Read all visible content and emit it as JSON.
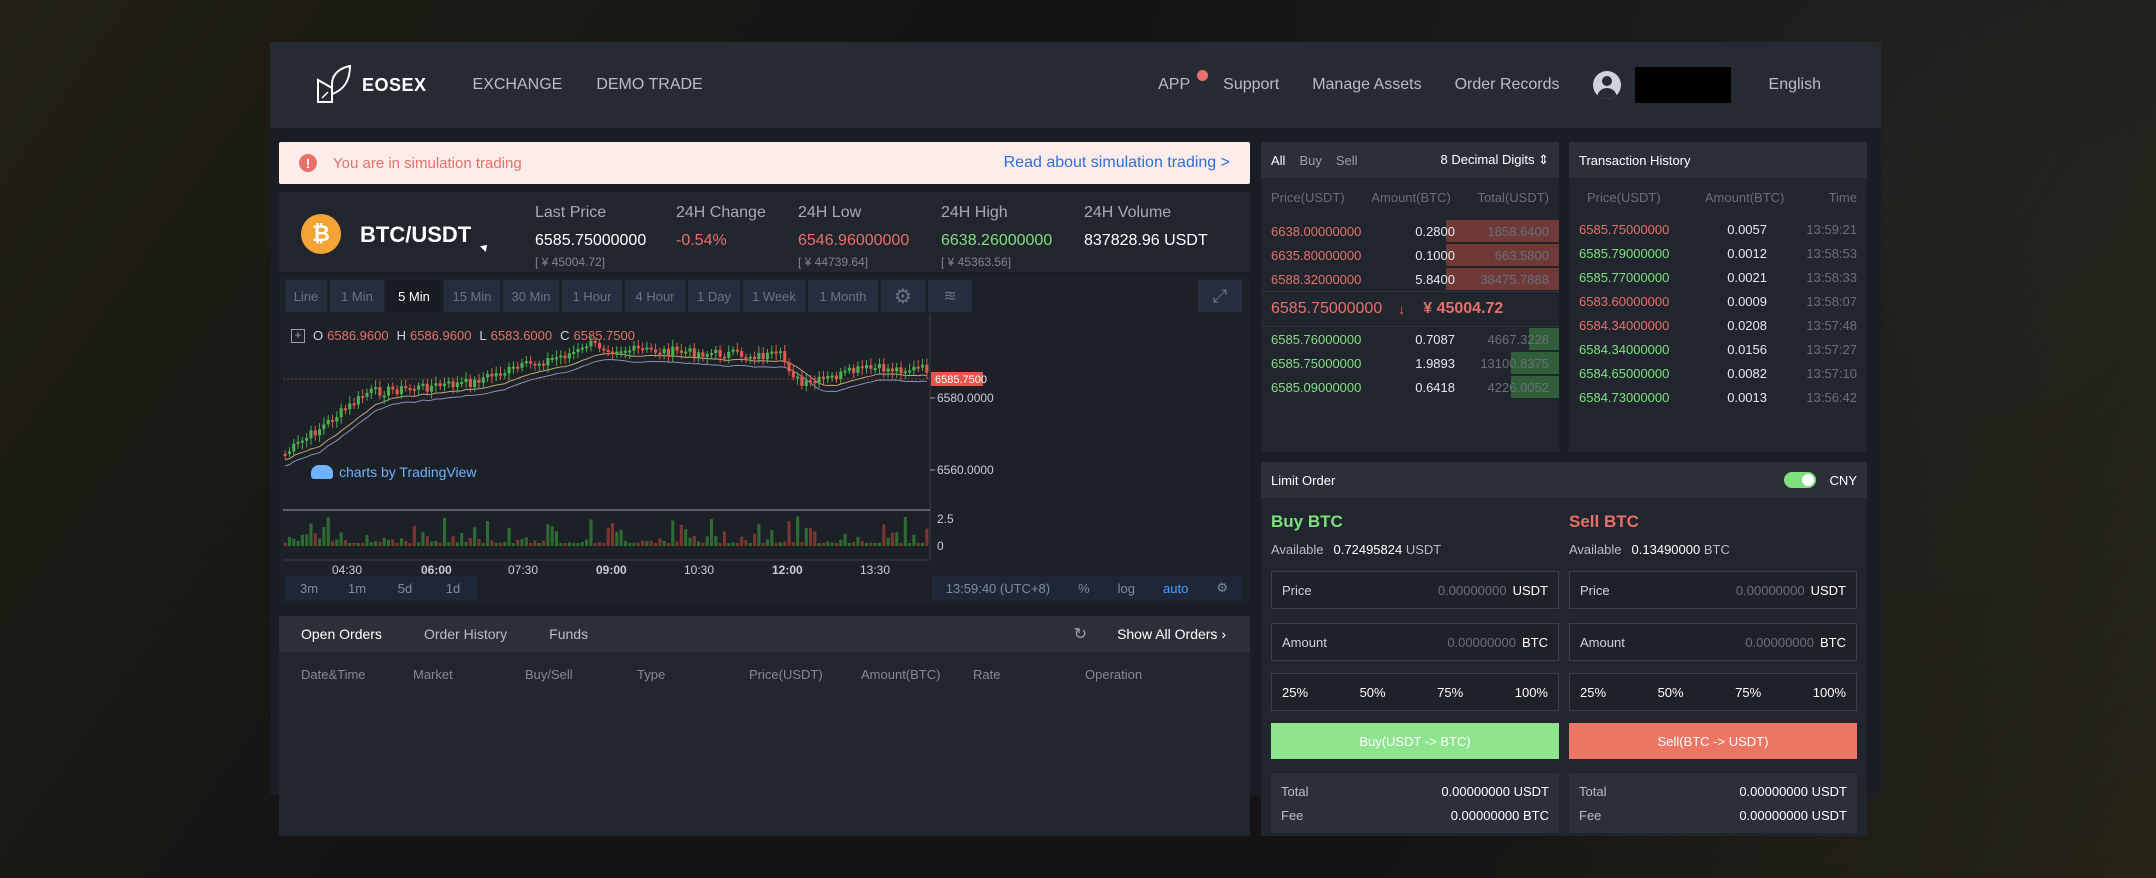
{
  "header": {
    "brand": "EOSEX",
    "nav": [
      "EXCHANGE",
      "DEMO TRADE"
    ],
    "right": {
      "app": "APP",
      "support": "Support",
      "manage_assets": "Manage Assets",
      "order_records": "Order Records",
      "language": "English"
    }
  },
  "notice": {
    "icon": "!",
    "text": "You are in simulation trading",
    "link": "Read about simulation trading >"
  },
  "ticker": {
    "coin_icon": "₿",
    "pair": "BTC/USDT",
    "last_price": {
      "label": "Last Price",
      "value": "6585.75000000",
      "sub": "[ ¥ 45004.72]"
    },
    "change": {
      "label": "24H Change",
      "value": "-0.54%"
    },
    "low": {
      "label": "24H Low",
      "value": "6546.96000000",
      "sub": "[ ¥ 44739.64]"
    },
    "high": {
      "label": "24H High",
      "value": "6638.26000000",
      "sub": "[ ¥ 45363.56]"
    },
    "volume": {
      "label": "24H Volume",
      "value": "837828.96 USDT"
    }
  },
  "chart": {
    "timeframes": [
      "Line",
      "1 Min",
      "5 Min",
      "15 Min",
      "30 Min",
      "1 Hour",
      "4 Hour",
      "1 Day",
      "1 Week",
      "1 Month"
    ],
    "active_timeframe": "5 Min",
    "icons": [
      "gear-icon",
      "indicator-icon",
      "fullscreen-icon"
    ],
    "ohlc": {
      "o_label": "O",
      "o": "6586.9600",
      "h_label": "H",
      "h": "6586.9600",
      "l_label": "L",
      "l": "6583.6000",
      "c_label": "C",
      "c": "6585.7500"
    },
    "current_price_tag": "6585.7500",
    "y_ticks": [
      "6580.0000",
      "6560.0000"
    ],
    "volume_ticks": [
      "2.5",
      "0"
    ],
    "x_ticks": [
      "04:30",
      "06:00",
      "07:30",
      "09:00",
      "10:30",
      "12:00",
      "13:30"
    ],
    "watermark": "charts by TradingView",
    "ranges": [
      "3m",
      "1m",
      "5d",
      "1d"
    ],
    "clock": "13:59:40 (UTC+8)",
    "scale_opts": [
      "%",
      "log",
      "auto"
    ],
    "colors": {
      "up": "#4caf50",
      "down": "#e05a4f",
      "tag": "#e8554d"
    }
  },
  "orders": {
    "tabs": [
      "Open Orders",
      "Order History",
      "Funds"
    ],
    "show_all": "Show All Orders",
    "columns": [
      "Date&Time",
      "Market",
      "Buy/Sell",
      "Type",
      "Price(USDT)",
      "Amount(BTC)",
      "Rate",
      "Operation"
    ]
  },
  "book": {
    "filters": [
      "All",
      "Buy",
      "Sell"
    ],
    "digits": "8 Decimal Digits",
    "columns": [
      "Price(USDT)",
      "Amount(BTC)",
      "Total(USDT)"
    ],
    "asks": [
      {
        "price": "6638.00000000",
        "amount": "0.2800",
        "total": "1858.6400",
        "depth": 0.38
      },
      {
        "price": "6635.80000000",
        "amount": "0.1000",
        "total": "663.5800",
        "depth": 0.38
      },
      {
        "price": "6588.32000000",
        "amount": "5.8400",
        "total": "38475.7888",
        "depth": 0.38
      }
    ],
    "mid_price": "6585.75000000",
    "mid_arrow": "↓",
    "mid_cny": "¥ 45004.72",
    "bids": [
      {
        "price": "6585.76000000",
        "amount": "0.7087",
        "total": "4667.3228",
        "depth": 0.1
      },
      {
        "price": "6585.75000000",
        "amount": "1.9893",
        "total": "13100.8375",
        "depth": 0.16
      },
      {
        "price": "6585.09000000",
        "amount": "0.6418",
        "total": "4226.0052",
        "depth": 0.16
      }
    ]
  },
  "trades": {
    "title": "Transaction History",
    "columns": [
      "Price(USDT)",
      "Amount(BTC)",
      "Time"
    ],
    "rows": [
      {
        "price": "6585.75000000",
        "amount": "0.0057",
        "time": "13:59:21",
        "side": "sell"
      },
      {
        "price": "6585.79000000",
        "amount": "0.0012",
        "time": "13:58:53",
        "side": "buy"
      },
      {
        "price": "6585.77000000",
        "amount": "0.0021",
        "time": "13:58:33",
        "side": "buy"
      },
      {
        "price": "6583.60000000",
        "amount": "0.0009",
        "time": "13:58:07",
        "side": "sell"
      },
      {
        "price": "6584.34000000",
        "amount": "0.0208",
        "time": "13:57:48",
        "side": "sell"
      },
      {
        "price": "6584.34000000",
        "amount": "0.0156",
        "time": "13:57:27",
        "side": "buy"
      },
      {
        "price": "6584.65000000",
        "amount": "0.0082",
        "time": "13:57:10",
        "side": "buy"
      },
      {
        "price": "6584.73000000",
        "amount": "0.0013",
        "time": "13:56:42",
        "side": "buy"
      }
    ]
  },
  "limit": {
    "title": "Limit Order",
    "currency_toggle": "CNY",
    "buy": {
      "title": "Buy BTC",
      "avail_label": "Available",
      "avail": "0.72495824",
      "avail_unit": "USDT",
      "price_label": "Price",
      "price": "0.00000000",
      "price_unit": "USDT",
      "amount_label": "Amount",
      "amount": "0.00000000",
      "amount_unit": "BTC",
      "button": "Buy(USDT -> BTC)",
      "total_label": "Total",
      "total": "0.00000000 USDT",
      "fee_label": "Fee",
      "fee": "0.00000000 BTC"
    },
    "sell": {
      "title": "Sell BTC",
      "avail_label": "Available",
      "avail": "0.13490000",
      "avail_unit": "BTC",
      "price_label": "Price",
      "price": "0.00000000",
      "price_unit": "USDT",
      "amount_label": "Amount",
      "amount": "0.00000000",
      "amount_unit": "BTC",
      "button": "Sell(BTC -> USDT)",
      "total_label": "Total",
      "total": "0.00000000 USDT",
      "fee_label": "Fee",
      "fee": "0.00000000 USDT"
    },
    "percents": [
      "25%",
      "50%",
      "75%",
      "100%"
    ]
  }
}
